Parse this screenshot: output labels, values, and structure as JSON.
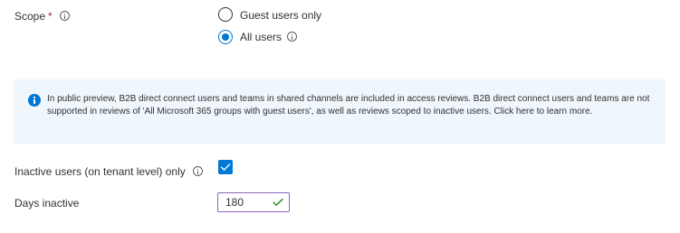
{
  "scope": {
    "label": "Scope",
    "required_marker": "*",
    "options": [
      {
        "label": "Guest users only",
        "selected": false
      },
      {
        "label": "All users",
        "selected": true
      }
    ]
  },
  "banner": {
    "icon": "info-icon",
    "text": "In public preview, B2B direct connect users and teams in shared channels are included in access reviews. B2B direct connect users and teams are not supported in reviews of 'All Microsoft 365 groups with guest users', as well as reviews scoped to inactive users. Click here to learn more."
  },
  "inactive_users": {
    "label": "Inactive users (on tenant level) only",
    "checked": true
  },
  "days_inactive": {
    "label": "Days inactive",
    "value": "180"
  },
  "colors": {
    "accent": "#0078d4",
    "focus_border": "#8764b8",
    "valid_check": "#107c10",
    "banner_bg": "#eff6fc",
    "required": "#a4262c"
  }
}
